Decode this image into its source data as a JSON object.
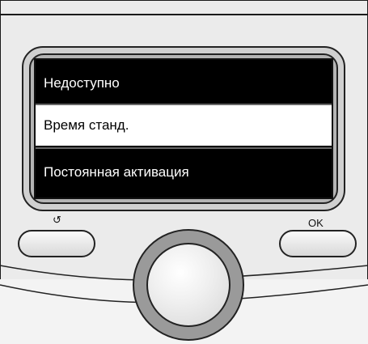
{
  "device": {
    "menu": {
      "items": [
        {
          "label": "Недоступно",
          "selected": false
        },
        {
          "label": "Время станд.",
          "selected": true
        },
        {
          "label": "Постоянная активация",
          "selected": false
        }
      ]
    },
    "controls": {
      "back_button": {
        "icon": "undo-arrow-icon",
        "label": "↺"
      },
      "ok_button": {
        "label": "OK"
      },
      "dial": {
        "icon": "rotary-knob"
      }
    }
  }
}
